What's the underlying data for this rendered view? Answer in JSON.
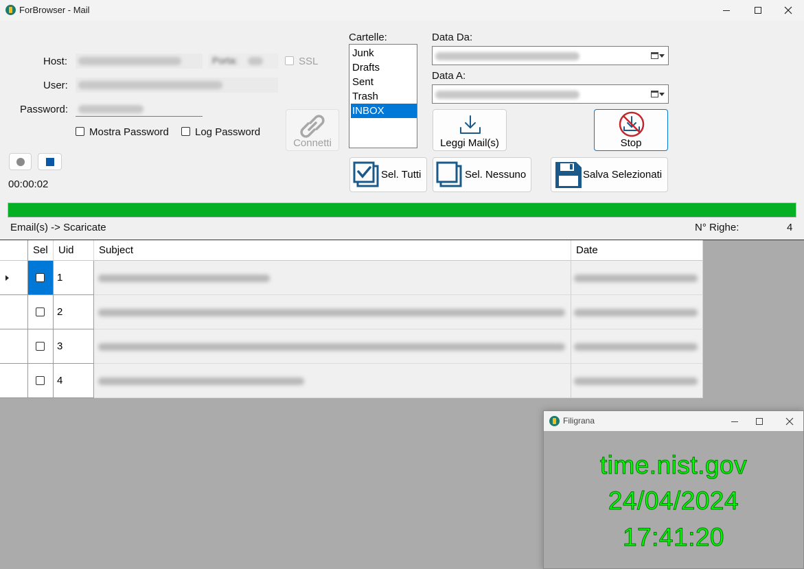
{
  "window": {
    "title": "ForBrowser - Mail"
  },
  "connection": {
    "host_label": "Host:",
    "user_label": "User:",
    "password_label": "Password:",
    "port_label": "Porta:",
    "ssl_label": "SSL",
    "show_password_label": "Mostra Password",
    "log_password_label": "Log Password",
    "connect_label": "Connetti",
    "timer": "00:00:02"
  },
  "folders": {
    "label": "Cartelle:",
    "items": [
      "Junk",
      "Drafts",
      "Sent",
      "Trash",
      "INBOX"
    ],
    "selected": "INBOX"
  },
  "dates": {
    "from_label": "Data Da:",
    "to_label": "Data A:"
  },
  "actions": {
    "read_mail": "Leggi Mail(s)",
    "stop": "Stop",
    "select_all": "Sel. Tutti",
    "select_none": "Sel. Nessuno",
    "save_selected": "Salva Selezionati"
  },
  "progress": {
    "value": 1.0
  },
  "status": {
    "message": "Email(s) -> Scaricate",
    "rows_label": "N° Righe:",
    "rows_count": "4"
  },
  "grid": {
    "columns": [
      "Sel",
      "Uid",
      "Subject",
      "Date"
    ],
    "rows": [
      {
        "uid": "1",
        "checked": false
      },
      {
        "uid": "2",
        "checked": false
      },
      {
        "uid": "3",
        "checked": false
      },
      {
        "uid": "4",
        "checked": false
      }
    ]
  },
  "filigrana": {
    "title": "Filigrana",
    "server": "time.nist.gov",
    "date": "24/04/2024",
    "time": "17:41:20"
  },
  "colors": {
    "progress": "#06b025",
    "selection": "#0078d7",
    "stop_icon": "#c0282d",
    "action_icon": "#1a5a8a",
    "filigrana_text": "#00ff00"
  }
}
